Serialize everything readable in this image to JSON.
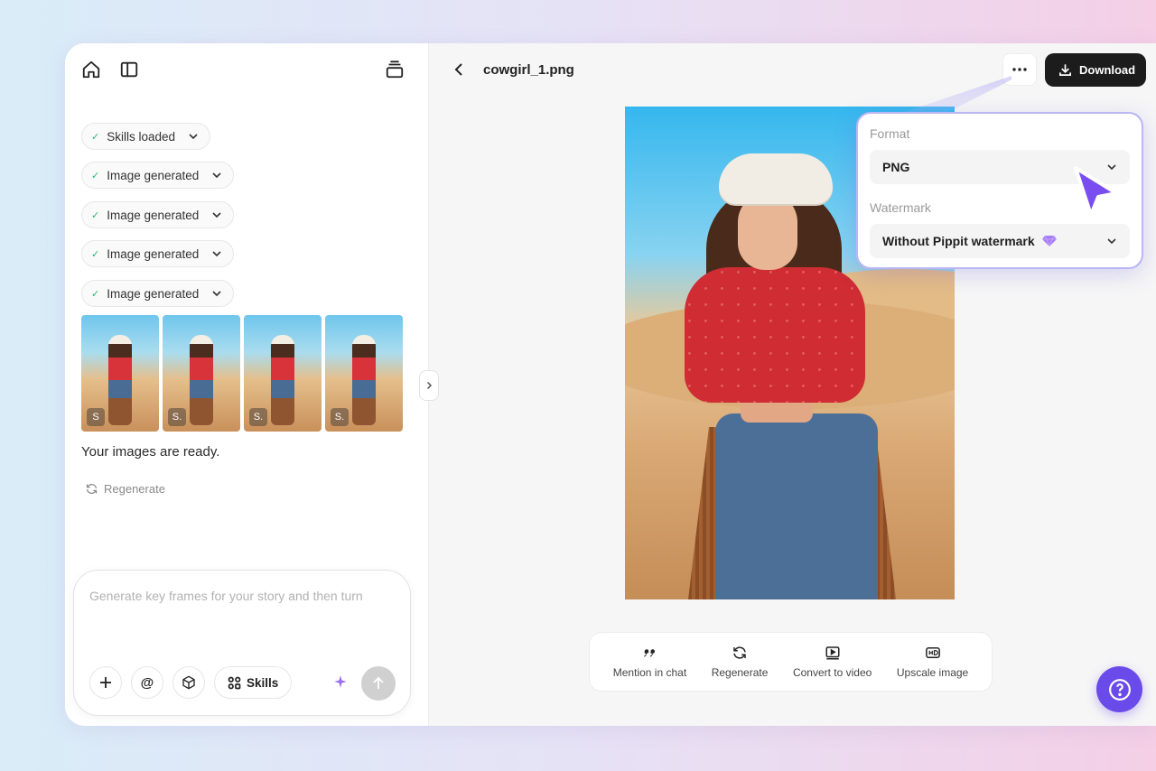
{
  "left_panel": {
    "steps": [
      {
        "label": "Skills loaded"
      },
      {
        "label": "Image generated"
      },
      {
        "label": "Image generated"
      },
      {
        "label": "Image generated"
      },
      {
        "label": "Image generated"
      }
    ],
    "thumbnails": [
      {
        "badge": "S"
      },
      {
        "badge": "S."
      },
      {
        "badge": "S."
      },
      {
        "badge": "S."
      }
    ],
    "message": "Your images are ready.",
    "regenerate_label": "Regenerate",
    "composer": {
      "placeholder": "Generate key frames for your story and then turn",
      "skills_label": "Skills"
    }
  },
  "viewer": {
    "filename": "cowgirl_1.png",
    "download_label": "Download",
    "popover": {
      "format_label": "Format",
      "format_value": "PNG",
      "watermark_label": "Watermark",
      "watermark_value": "Without Pippit watermark"
    },
    "actions": [
      {
        "label": "Mention in chat",
        "icon": "quote-icon"
      },
      {
        "label": "Regenerate",
        "icon": "refresh-icon"
      },
      {
        "label": "Convert to video",
        "icon": "play-video-icon"
      },
      {
        "label": "Upscale image",
        "icon": "hd-icon"
      }
    ]
  },
  "colors": {
    "accent": "#6a4bea",
    "download_bg": "#1c1c1c",
    "check": "#2fb36b",
    "popover_border": "#b9b7f4"
  }
}
